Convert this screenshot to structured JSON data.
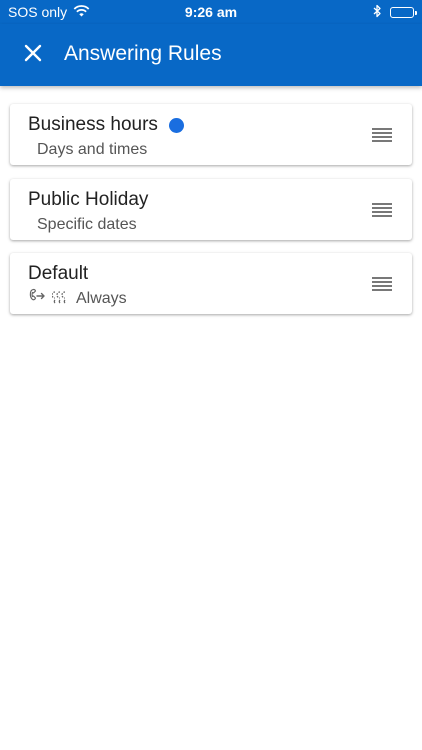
{
  "status_bar": {
    "carrier": "SOS only",
    "time": "9:26 am"
  },
  "header": {
    "title": "Answering Rules",
    "close_icon": "close-icon"
  },
  "colors": {
    "brand": "#0868c6",
    "active_dot": "#1a6ee0"
  },
  "rules": [
    {
      "title": "Business hours",
      "subtitle": "Days and times",
      "active": true
    },
    {
      "title": "Public Holiday",
      "subtitle": "Specific dates",
      "active": false
    },
    {
      "title": "Default",
      "subtitle": "Always",
      "active": false,
      "icons": [
        "call-forward-icon",
        "voicemail-icon"
      ]
    }
  ]
}
